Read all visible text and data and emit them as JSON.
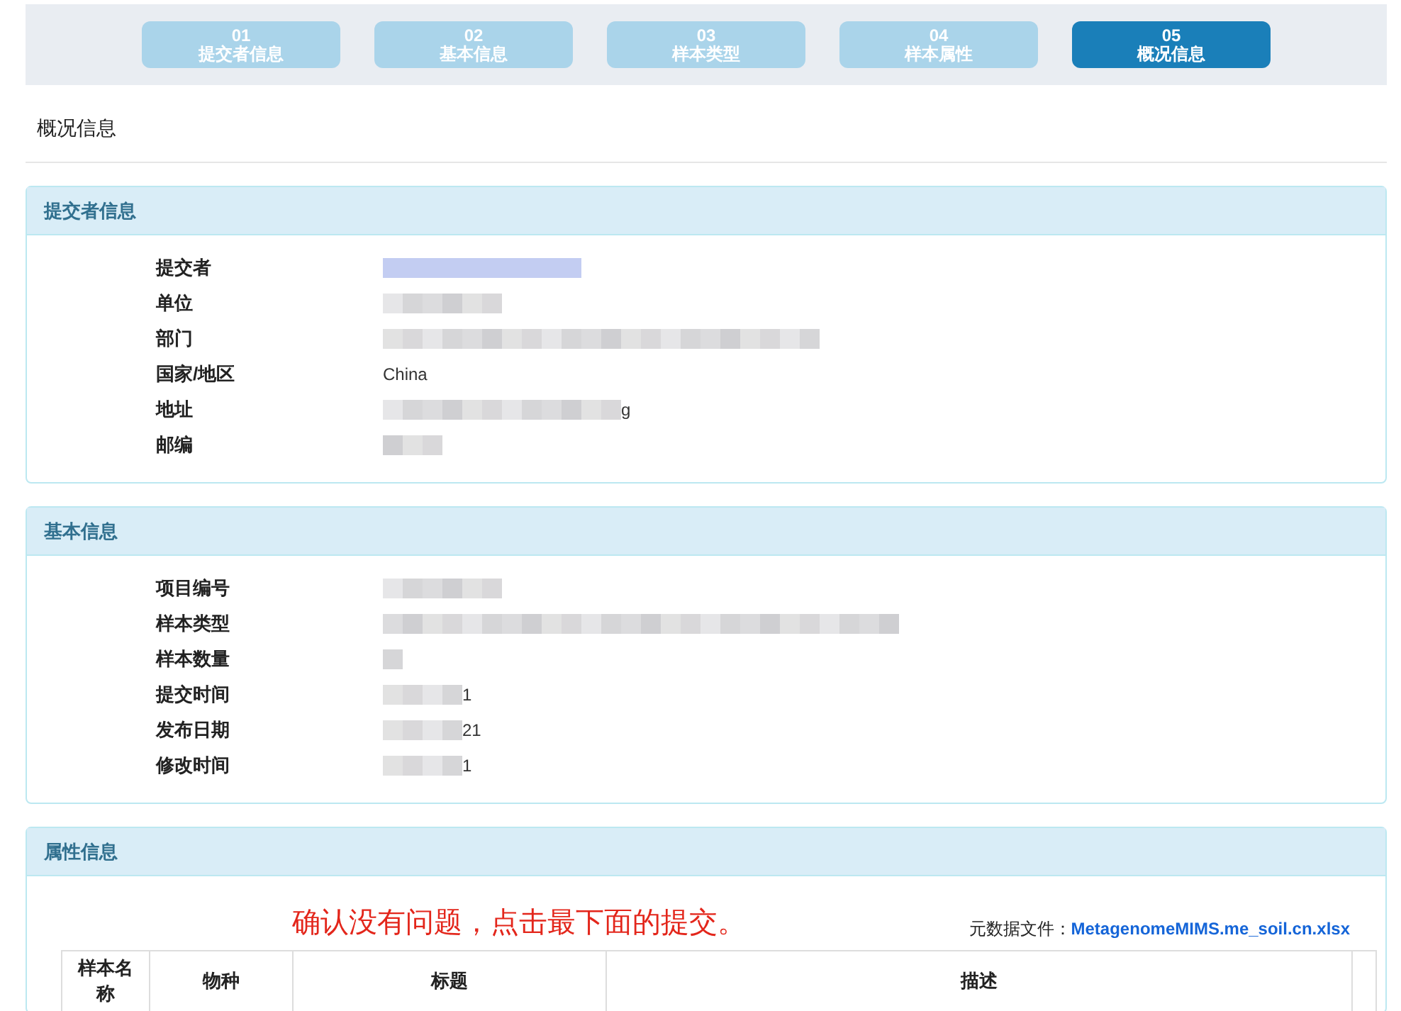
{
  "steps": [
    {
      "number": "01",
      "label": "提交者信息",
      "selected": false
    },
    {
      "number": "02",
      "label": "基本信息",
      "selected": false
    },
    {
      "number": "03",
      "label": "样本类型",
      "selected": false
    },
    {
      "number": "04",
      "label": "样本属性",
      "selected": false
    },
    {
      "number": "05",
      "label": "概况信息",
      "selected": true
    }
  ],
  "page_title": "概况信息",
  "sections": [
    {
      "title": "提交者信息",
      "fields": [
        {
          "label": "提交者",
          "kind": "blurred"
        },
        {
          "label": "单位",
          "kind": "blurred"
        },
        {
          "label": "部门",
          "kind": "blurred"
        },
        {
          "label": "国家/地区",
          "kind": "text",
          "value": "China"
        },
        {
          "label": "地址",
          "kind": "blurred",
          "tail": "g"
        },
        {
          "label": "邮编",
          "kind": "blurred"
        }
      ]
    },
    {
      "title": "基本信息",
      "fields": [
        {
          "label": "项目编号",
          "kind": "blurred"
        },
        {
          "label": "样本类型",
          "kind": "blurred"
        },
        {
          "label": "样本数量",
          "kind": "blurred"
        },
        {
          "label": "提交时间",
          "kind": "blurred",
          "tail": "1"
        },
        {
          "label": "发布日期",
          "kind": "blurred",
          "tail": "21"
        },
        {
          "label": "修改时间",
          "kind": "blurred",
          "tail": "1"
        }
      ]
    }
  ],
  "attributes": {
    "title": "属性信息",
    "note": "确认没有问题，点击最下面的提交。",
    "file_label": "元数据文件：",
    "file_link": "MetagenomeMIMS.me_soil.cn.xlsx",
    "columns": [
      "样本名称",
      "物种",
      "标题",
      "描述"
    ]
  }
}
